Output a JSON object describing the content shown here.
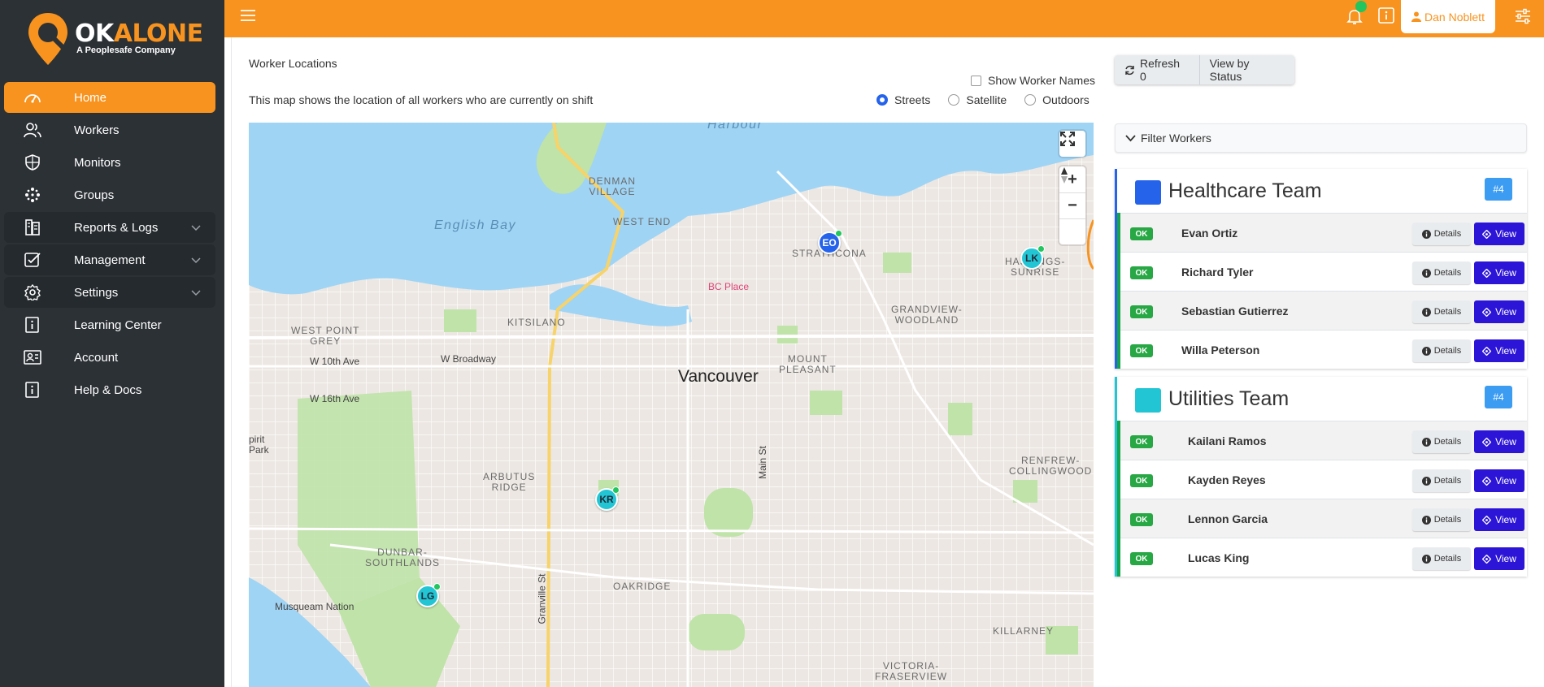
{
  "brand": {
    "name_ok": "OK",
    "name_alone": "ALONE",
    "tagline": "A Peoplesafe Company",
    "accent_color": "#f7931e"
  },
  "sidebar": {
    "items": [
      {
        "label": "Home",
        "icon": "dashboard-icon",
        "active": true
      },
      {
        "label": "Workers",
        "icon": "users-icon"
      },
      {
        "label": "Monitors",
        "icon": "shield-icon"
      },
      {
        "label": "Groups",
        "icon": "groups-icon"
      },
      {
        "label": "Reports & Logs",
        "icon": "reports-icon",
        "expandable": true
      },
      {
        "label": "Management",
        "icon": "checklist-icon",
        "expandable": true
      },
      {
        "label": "Settings",
        "icon": "gear-icon",
        "expandable": true
      },
      {
        "label": "Learning Center",
        "icon": "info-icon"
      },
      {
        "label": "Account",
        "icon": "account-icon"
      },
      {
        "label": "Help & Docs",
        "icon": "help-icon"
      }
    ]
  },
  "topbar": {
    "menu_icon": "hamburger-icon",
    "notification_icon": "bell-icon",
    "info_icon": "info-icon",
    "user_name": "Dan Noblett",
    "settings_icon": "sliders-icon"
  },
  "map_panel": {
    "title": "Worker Locations",
    "description": "This map shows the location of all workers who are currently on shift",
    "show_names_label": "Show Worker Names",
    "show_names_checked": false,
    "map_styles": [
      {
        "label": "Streets",
        "selected": true
      },
      {
        "label": "Satellite",
        "selected": false
      },
      {
        "label": "Outdoors",
        "selected": false
      }
    ],
    "map_labels": {
      "harbour": "Harbour",
      "english_bay": "English Bay",
      "denman_village": "DENMAN\nVILLAGE",
      "west_end": "WEST END",
      "strathcona": "STRATHCONA",
      "hastings_sunrise": "HASTINGS-\nSUNRISE",
      "bc_place": "BC Place",
      "kitsilano": "KITSILANO",
      "grandview_woodland": "GRANDVIEW-\nWOODLAND",
      "west_point_grey": "WEST POINT\nGREY",
      "w_broadway": "W Broadway",
      "w_10th": "W 10th Ave",
      "mount_pleasant": "MOUNT\nPLEASANT",
      "vancouver": "Vancouver",
      "w_16th": "W 16th Ave",
      "spirit_park": "pirit\nPark",
      "main_st": "Main St",
      "renfrew": "RENFREW-\nCOLLINGWOOD",
      "arbutus_ridge": "ARBUTUS\nRIDGE",
      "dunbar": "DUNBAR-\nSOUTHLANDS",
      "oakridge": "OAKRIDGE",
      "granville_st": "Granville St",
      "musqueam": "Musqueam Nation",
      "killarney": "KILLARNEY",
      "victoria_fraserview": "VICTORIA-\nFRASERVIEW"
    },
    "markers": [
      {
        "initials": "EO",
        "team": "healthcare"
      },
      {
        "initials": "LK",
        "team": "utilities"
      },
      {
        "initials": "KR",
        "team": "utilities"
      },
      {
        "initials": "LG",
        "team": "utilities"
      }
    ]
  },
  "toolbar": {
    "refresh_label": "Refresh 0",
    "view_by_status_label": "View by Status",
    "filter_label": "Filter Workers"
  },
  "teams": [
    {
      "name": "Healthcare Team",
      "color": "#2563eb",
      "badge": "#4",
      "workers": [
        {
          "status": "OK",
          "name": "Evan Ortiz"
        },
        {
          "status": "OK",
          "name": "Richard Tyler"
        },
        {
          "status": "OK",
          "name": "Sebastian Gutierrez"
        },
        {
          "status": "OK",
          "name": "Willa Peterson"
        }
      ]
    },
    {
      "name": "Utilities Team",
      "color": "#22c5d4",
      "badge": "#4",
      "workers": [
        {
          "status": "OK",
          "name": "Kailani Ramos"
        },
        {
          "status": "OK",
          "name": "Kayden Reyes"
        },
        {
          "status": "OK",
          "name": "Lennon Garcia"
        },
        {
          "status": "OK",
          "name": "Lucas King"
        }
      ]
    }
  ],
  "row_buttons": {
    "details_label": "Details",
    "view_label": "View"
  }
}
